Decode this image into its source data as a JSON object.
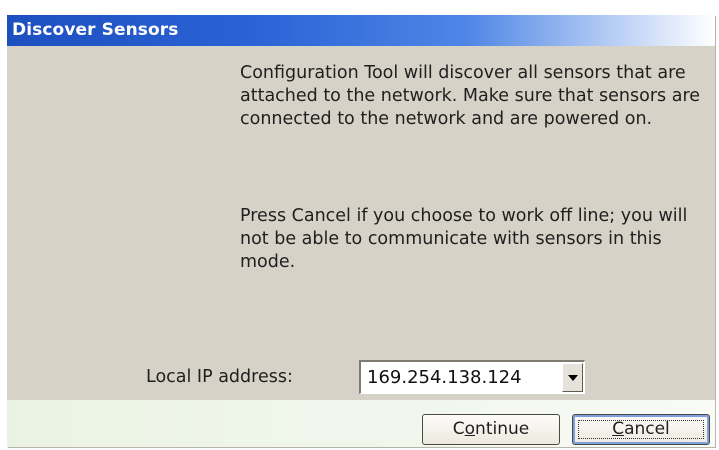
{
  "window": {
    "title": "Discover Sensors"
  },
  "message": {
    "paragraph1": "Configuration Tool will discover all sensors that are attached to the network. Make sure that sensors are connected to the network and are powered on.",
    "paragraph2": "Press Cancel if you choose to work off line; you will not be able to communicate with sensors in this mode."
  },
  "ip": {
    "label": "Local IP address:",
    "selected": "169.254.138.124"
  },
  "buttons": {
    "continue": {
      "pre": "C",
      "key": "o",
      "post": "ntinue"
    },
    "cancel": {
      "pre": "",
      "key": "C",
      "post": "ancel"
    }
  },
  "colors": {
    "dialog_bg": "#d7d2c7",
    "titlebar_start": "#1d4fbf",
    "titlebar_end": "#ffffff",
    "footer_bg": "#eaf3e3"
  },
  "icons": {
    "dropdown": "chevron-down-icon"
  }
}
